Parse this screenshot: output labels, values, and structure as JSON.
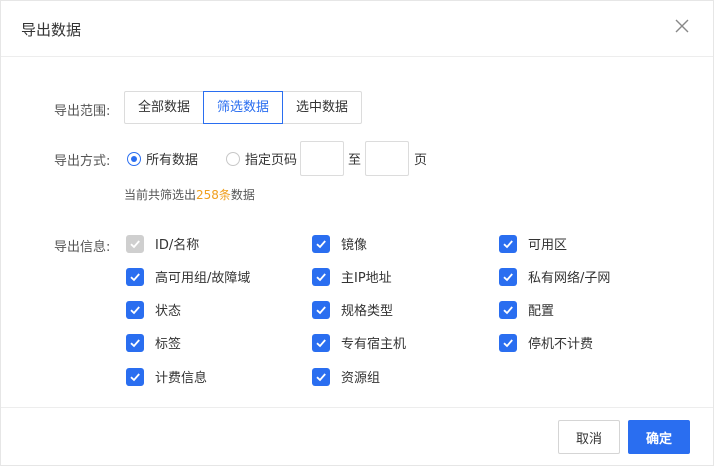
{
  "dialog": {
    "title": "导出数据",
    "close_icon": "close-icon"
  },
  "range": {
    "label": "导出范围:",
    "options": [
      "全部数据",
      "筛选数据",
      "选中数据"
    ],
    "selected": "筛选数据"
  },
  "mode": {
    "label": "导出方式:",
    "all_label": "所有数据",
    "pages_label": "指定页码",
    "selected": "所有数据",
    "from_value": "",
    "to_label": "至",
    "to_value": "",
    "page_suffix": "页"
  },
  "summary": {
    "prefix": "当前共筛选出",
    "count": "258条",
    "suffix": "数据"
  },
  "info": {
    "label": "导出信息:",
    "fields": [
      {
        "label": "ID/名称",
        "checked": true,
        "disabled": true
      },
      {
        "label": "镜像",
        "checked": true
      },
      {
        "label": "可用区",
        "checked": true
      },
      {
        "label": "高可用组/故障域",
        "checked": true
      },
      {
        "label": "主IP地址",
        "checked": true
      },
      {
        "label": "私有网络/子网",
        "checked": true
      },
      {
        "label": "状态",
        "checked": true
      },
      {
        "label": "规格类型",
        "checked": true
      },
      {
        "label": "配置",
        "checked": true
      },
      {
        "label": "标签",
        "checked": true
      },
      {
        "label": "专有宿主机",
        "checked": true
      },
      {
        "label": "停机不计费",
        "checked": true
      },
      {
        "label": "计费信息",
        "checked": true
      },
      {
        "label": "资源组",
        "checked": true
      }
    ]
  },
  "footer": {
    "cancel_label": "取消",
    "ok_label": "确定"
  },
  "colors": {
    "accent": "#2a6ef0",
    "highlight": "#f0a020",
    "disabled_check": "#cfcfcf"
  }
}
